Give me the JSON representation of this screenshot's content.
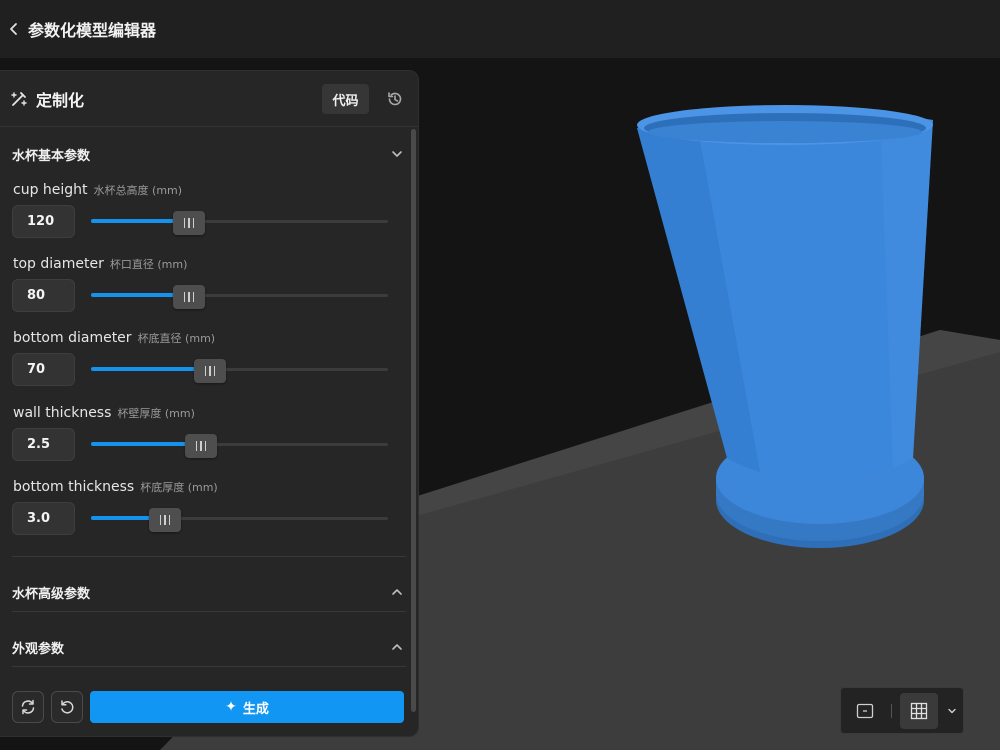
{
  "app": {
    "title": "参数化模型编辑器"
  },
  "panel": {
    "title": "定制化",
    "code_button": "代码",
    "sections": {
      "basic": {
        "title": "水杯基本参数",
        "expanded": true
      },
      "advanced": {
        "title": "水杯高级参数",
        "expanded": false
      },
      "appearance": {
        "title": "外观参数",
        "expanded": false
      }
    },
    "params": [
      {
        "name": "cup height",
        "sub": "水杯总高度 (mm)",
        "value": "120",
        "slider_fraction": 0.33
      },
      {
        "name": "top diameter",
        "sub": "杯口直径 (mm)",
        "value": "80",
        "slider_fraction": 0.33
      },
      {
        "name": "bottom diameter",
        "sub": "杯底直径 (mm)",
        "value": "70",
        "slider_fraction": 0.4
      },
      {
        "name": "wall thickness",
        "sub": "杯壁厚度 (mm)",
        "value": "2.5",
        "slider_fraction": 0.37
      },
      {
        "name": "bottom thickness",
        "sub": "杯底厚度 (mm)",
        "value": "3.0",
        "slider_fraction": 0.25
      }
    ],
    "footer": {
      "generate_label": "生成"
    }
  },
  "view_toolbar": {
    "active_view": "grid"
  },
  "colors": {
    "accent": "#1296f3",
    "slider_fill": "#1593ec",
    "model": "#3b87dc"
  }
}
